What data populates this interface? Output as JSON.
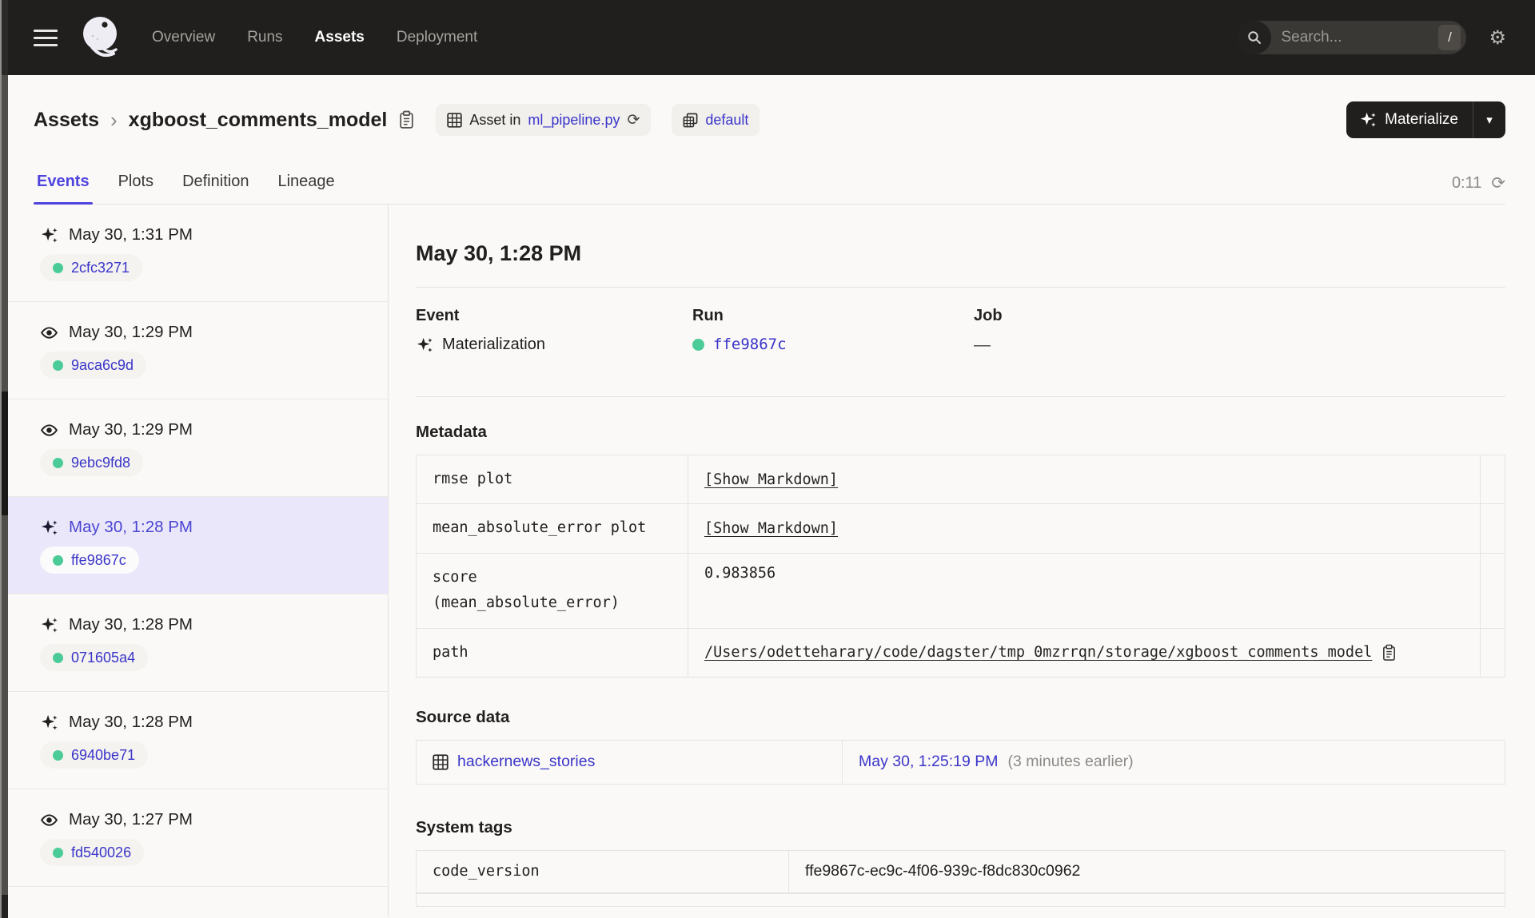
{
  "colors": {
    "accent": "#4F43DD",
    "link": "#3B35C9",
    "success_green": "#4BCB97",
    "nav_bg": "#211F1E",
    "selected_row_bg": "#E9E7F9",
    "page_bg": "#FAF9F7",
    "border": "#E6E4E0"
  },
  "icons": {
    "gear": "⚙",
    "refresh": "⟳",
    "caret": "▾"
  },
  "nav": {
    "items": [
      {
        "label": "Overview"
      },
      {
        "label": "Runs"
      },
      {
        "label": "Assets"
      },
      {
        "label": "Deployment"
      }
    ],
    "search": {
      "placeholder": "Search...",
      "shortcut": "/"
    }
  },
  "header": {
    "breadcrumb": {
      "root": "Assets",
      "separator": "›",
      "asset": "xgboost_comments_model"
    },
    "asset_location": {
      "prefix": "Asset in",
      "link": "ml_pipeline.py"
    },
    "group": {
      "label": "default"
    },
    "materialize": {
      "label": "Materialize"
    }
  },
  "tabs": {
    "items": [
      {
        "label": "Events"
      },
      {
        "label": "Plots"
      },
      {
        "label": "Definition"
      },
      {
        "label": "Lineage"
      }
    ],
    "timer": "0:11"
  },
  "sidebar": {
    "events": [
      {
        "type": "materialization",
        "time": "May 30, 1:31 PM",
        "run_id": "2cfc3271",
        "selected": false
      },
      {
        "type": "observation",
        "time": "May 30, 1:29 PM",
        "run_id": "9aca6c9d",
        "selected": false
      },
      {
        "type": "observation",
        "time": "May 30, 1:29 PM",
        "run_id": "9ebc9fd8",
        "selected": false
      },
      {
        "type": "materialization",
        "time": "May 30, 1:28 PM",
        "run_id": "ffe9867c",
        "selected": true
      },
      {
        "type": "materialization",
        "time": "May 30, 1:28 PM",
        "run_id": "071605a4",
        "selected": false
      },
      {
        "type": "materialization",
        "time": "May 30, 1:28 PM",
        "run_id": "6940be71",
        "selected": false
      },
      {
        "type": "observation",
        "time": "May 30, 1:27 PM",
        "run_id": "fd540026",
        "selected": false
      }
    ]
  },
  "detail": {
    "title": "May 30, 1:28 PM",
    "event_label": "Event",
    "event_value": "Materialization",
    "run_label": "Run",
    "run_value": "ffe9867c",
    "job_label": "Job",
    "job_value": "—",
    "metadata": {
      "heading": "Metadata",
      "rows": [
        {
          "key": "rmse plot",
          "value": "[Show Markdown]"
        },
        {
          "key": "mean_absolute_error plot",
          "value": "[Show Markdown]"
        },
        {
          "key": "score (mean_absolute_error)",
          "value": "0.983856"
        },
        {
          "key": "path",
          "value": "/Users/odetteharary/code/dagster/tmp_0mzrrqn/storage/xgboost_comments_model"
        }
      ]
    },
    "source_data": {
      "heading": "Source data",
      "asset": "hackernews_stories",
      "time": "May 30, 1:25:19 PM",
      "relative": "(3 minutes earlier)"
    },
    "system_tags": {
      "heading": "System tags",
      "rows": [
        {
          "key": "code_version",
          "value": "ffe9867c-ec9c-4f06-939c-f8dc830c0962"
        }
      ]
    }
  }
}
